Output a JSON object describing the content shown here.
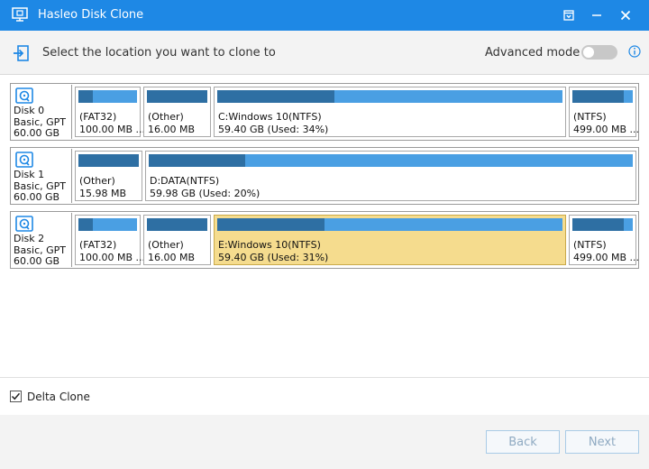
{
  "window": {
    "title": "Hasleo Disk Clone"
  },
  "header": {
    "instruction": "Select the location you want to clone to",
    "advanced_mode_label": "Advanced mode",
    "advanced_mode_on": false
  },
  "disks": [
    {
      "name": "Disk 0",
      "type": "Basic, GPT",
      "size": "60.00 GB",
      "partitions": [
        {
          "label": "(FAT32)",
          "detail": "100.00 MB ...",
          "used": 0.25
        },
        {
          "label": "(Other)",
          "detail": "16.00 MB",
          "used": 1.0
        },
        {
          "label": "C:Windows 10(NTFS)",
          "detail": "59.40 GB (Used: 34%)",
          "used": 0.34
        },
        {
          "label": "(NTFS)",
          "detail": "499.00 MB ...",
          "used": 0.85
        }
      ]
    },
    {
      "name": "Disk 1",
      "type": "Basic, GPT",
      "size": "60.00 GB",
      "partitions": [
        {
          "label": "(Other)",
          "detail": "15.98 MB",
          "used": 1.0
        },
        {
          "label": "D:DATA(NTFS)",
          "detail": "59.98 GB (Used: 20%)",
          "used": 0.2
        }
      ]
    },
    {
      "name": "Disk 2",
      "type": "Basic, GPT",
      "size": "60.00 GB",
      "partitions": [
        {
          "label": "(FAT32)",
          "detail": "100.00 MB ...",
          "used": 0.25
        },
        {
          "label": "(Other)",
          "detail": "16.00 MB",
          "used": 1.0
        },
        {
          "label": "E:Windows 10(NTFS)",
          "detail": "59.40 GB (Used: 31%)",
          "used": 0.31,
          "selected": true
        },
        {
          "label": "(NTFS)",
          "detail": "499.00 MB ...",
          "used": 0.85
        }
      ]
    }
  ],
  "options": {
    "delta_clone_label": "Delta Clone",
    "delta_clone_checked": true
  },
  "footer": {
    "back_label": "Back",
    "next_label": "Next"
  },
  "colors": {
    "titlebar": "#1e88e5",
    "bar_free": "#4a9fe3",
    "bar_used": "#2e6fa3",
    "selected": "#f5dc8e"
  }
}
